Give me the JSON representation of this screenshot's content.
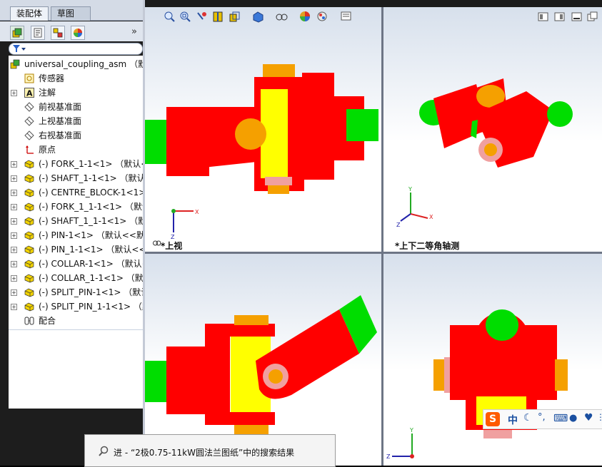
{
  "tabs": [
    {
      "label": "装配体"
    },
    {
      "label": "草图"
    }
  ],
  "feature_tree": {
    "root": "universal_coupling_asm （默认",
    "items": [
      {
        "label": "传感器",
        "icon": "sensor-icon"
      },
      {
        "label": "注解",
        "icon": "annotation-icon"
      },
      {
        "label": "前视基准面",
        "icon": "plane-icon"
      },
      {
        "label": "上视基准面",
        "icon": "plane-icon"
      },
      {
        "label": "右视基准面",
        "icon": "plane-icon"
      },
      {
        "label": "原点",
        "icon": "origin-icon"
      },
      {
        "label": "(-) FORK_1-1<1> （默认<<",
        "icon": "part-icon"
      },
      {
        "label": "(-) SHAFT_1-1<1> （默认<",
        "icon": "part-icon"
      },
      {
        "label": "(-) CENTRE_BLOCK-1<1>",
        "icon": "part-icon"
      },
      {
        "label": "(-) FORK_1_1-1<1> （默认",
        "icon": "part-icon"
      },
      {
        "label": "(-) SHAFT_1_1-1<1> （默认",
        "icon": "part-icon"
      },
      {
        "label": "(-) PIN-1<1> （默认<<默认",
        "icon": "part-icon"
      },
      {
        "label": "(-) PIN_1-1<1> （默认<<默",
        "icon": "part-icon"
      },
      {
        "label": "(-) COLLAR-1<1> （默认<<",
        "icon": "part-icon"
      },
      {
        "label": "(-) COLLAR_1-1<1> （默认",
        "icon": "part-icon"
      },
      {
        "label": "(-) SPLIT_PIN-1<1> （默认",
        "icon": "part-icon"
      },
      {
        "label": "(-) SPLIT_PIN_1-1<1> （默认",
        "icon": "part-icon"
      },
      {
        "label": "配合",
        "icon": "mates-icon"
      }
    ]
  },
  "viewports": {
    "top": {
      "label": "*上视"
    },
    "iso": {
      "label": "*上下二等角轴测"
    }
  },
  "axes": {
    "x": "X",
    "y": "Y",
    "z": "Z"
  },
  "search_popup": {
    "text": "进 - “2极0.75-11kW圆法兰图纸”中的搜索结果"
  },
  "ime": {
    "label": "中",
    "symbols": "°,"
  },
  "colors": {
    "part_red": "#ff0000",
    "part_yellow": "#ffff00",
    "part_orange": "#f5a000",
    "part_green": "#00dd00",
    "pink": "#f0a0a0"
  }
}
